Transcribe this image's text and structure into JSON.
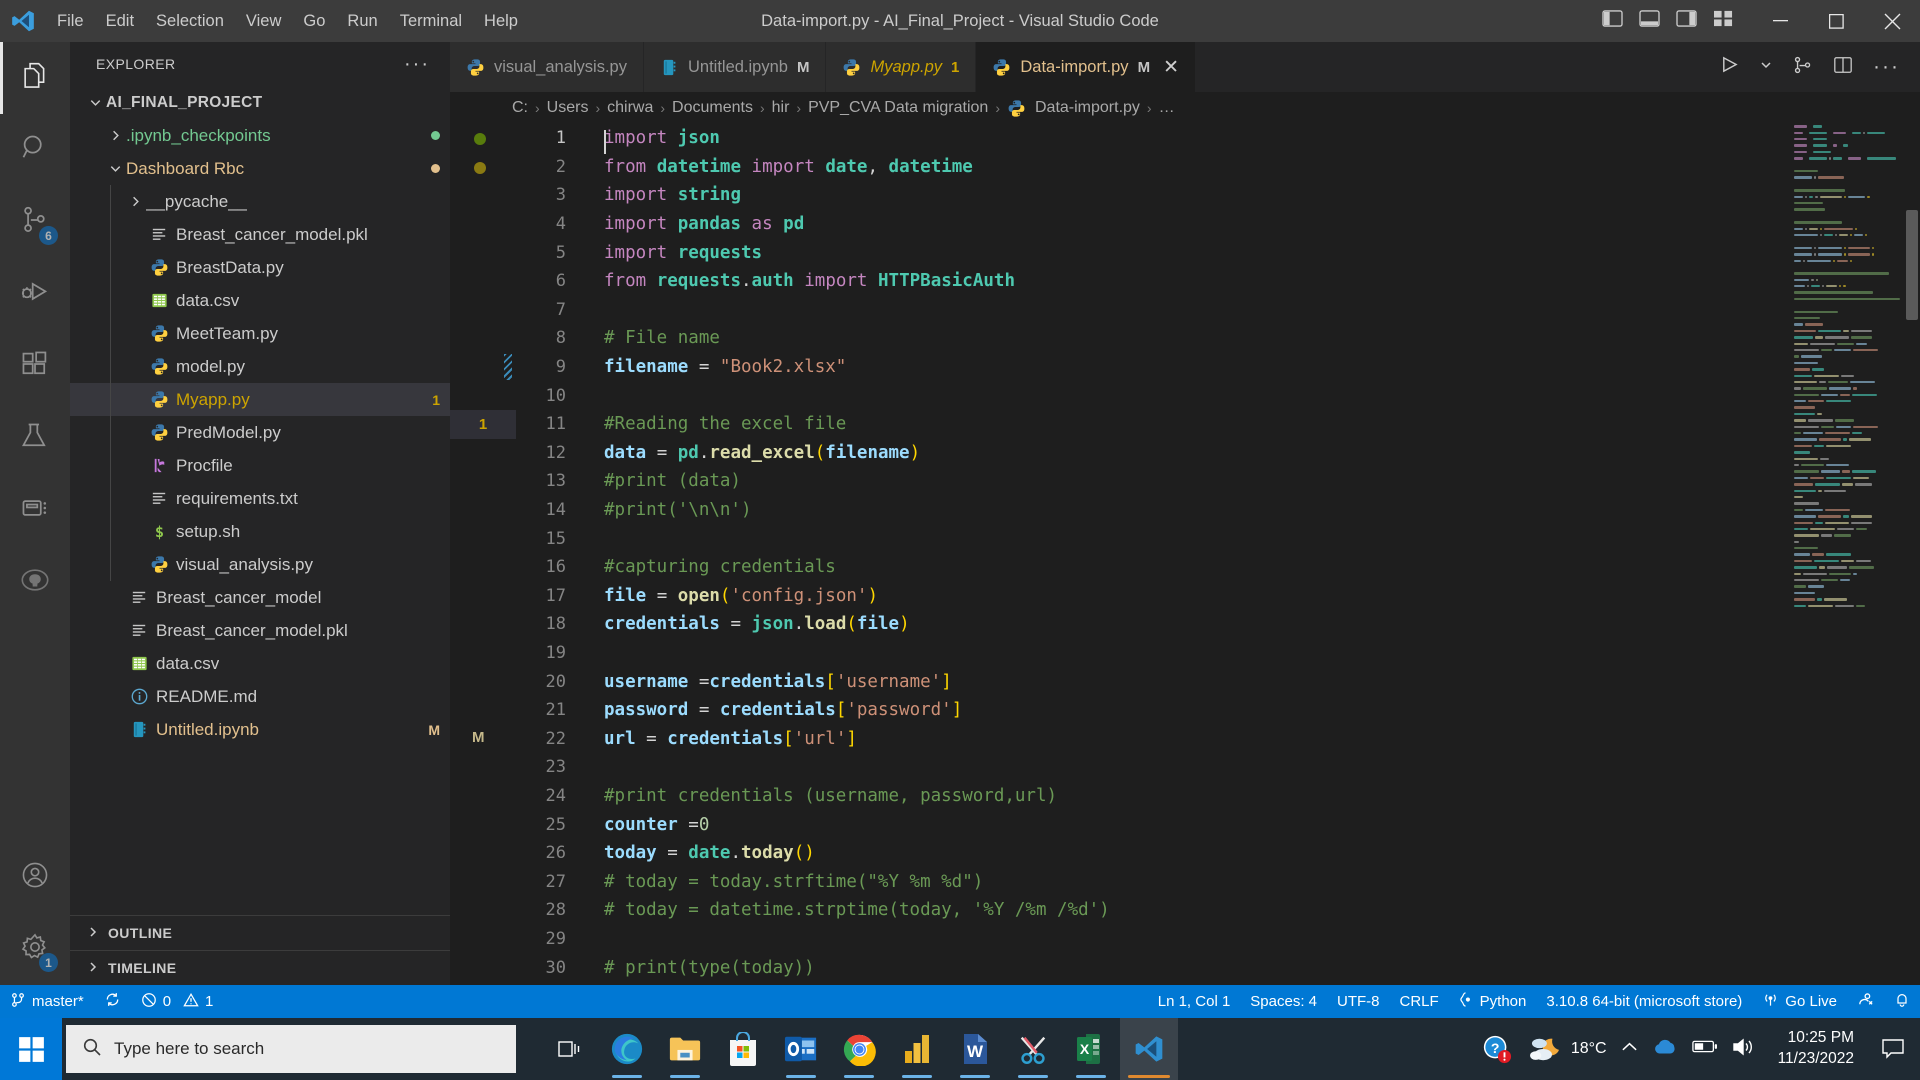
{
  "titlebar": {
    "logo_icon": "vscode-logo-icon",
    "menus": [
      "File",
      "Edit",
      "Selection",
      "View",
      "Go",
      "Run",
      "Terminal",
      "Help"
    ],
    "window_title": "Data-import.py - AI_Final_Project - Visual Studio Code",
    "layout_icons": [
      "toggle-primary-sidebar-icon",
      "toggle-panel-icon",
      "toggle-secondary-sidebar-icon",
      "customize-layout-icon"
    ],
    "window_controls": [
      "minimize-icon",
      "maximize-icon",
      "close-icon"
    ]
  },
  "activitybar": {
    "items": [
      {
        "name": "explorer",
        "icon": "files-icon",
        "active": true,
        "badge": ""
      },
      {
        "name": "search",
        "icon": "search-icon",
        "active": false,
        "badge": ""
      },
      {
        "name": "source-control",
        "icon": "source-control-icon",
        "active": false,
        "badge": "6"
      },
      {
        "name": "run-and-debug",
        "icon": "run-debug-icon",
        "active": false,
        "badge": ""
      },
      {
        "name": "extensions",
        "icon": "extensions-icon",
        "active": false,
        "badge": ""
      },
      {
        "name": "testing",
        "icon": "beaker-icon",
        "active": false,
        "badge": ""
      },
      {
        "name": "remote-explorer",
        "icon": "remote-explorer-icon",
        "active": false,
        "badge": ""
      },
      {
        "name": "github",
        "icon": "github-icon",
        "active": false,
        "badge": ""
      }
    ],
    "bottom": [
      {
        "name": "accounts",
        "icon": "account-icon",
        "badge": ""
      },
      {
        "name": "settings",
        "icon": "gear-icon",
        "badge": "1"
      }
    ]
  },
  "sidebar": {
    "title": "EXPLORER",
    "more_actions": "···",
    "tree": [
      {
        "label": "AI_FINAL_PROJECT",
        "depth": 0,
        "kind": "root",
        "chevron": "down",
        "icon": "",
        "badge": "",
        "color": "#cccccc",
        "dot": "",
        "selected": false
      },
      {
        "label": ".ipynb_checkpoints",
        "depth": 1,
        "kind": "folder",
        "chevron": "right",
        "icon": "",
        "badge": "",
        "color": "#73c991",
        "dot": "#73c991",
        "selected": false
      },
      {
        "label": "Dashboard Rbc",
        "depth": 1,
        "kind": "folder",
        "chevron": "down",
        "icon": "",
        "badge": "",
        "color": "#e2c08d",
        "dot": "#e2c08d",
        "selected": false
      },
      {
        "label": "__pycache__",
        "depth": 2,
        "kind": "folder",
        "chevron": "right",
        "icon": "",
        "badge": "",
        "color": "#cccccc",
        "dot": "",
        "selected": false
      },
      {
        "label": "Breast_cancer_model.pkl",
        "depth": 2,
        "kind": "file",
        "chevron": "",
        "icon": "lines-file-icon",
        "badge": "",
        "color": "#cccccc",
        "dot": "",
        "selected": false
      },
      {
        "label": "BreastData.py",
        "depth": 2,
        "kind": "file",
        "chevron": "",
        "icon": "python-icon",
        "badge": "",
        "color": "#cccccc",
        "dot": "",
        "selected": false
      },
      {
        "label": "data.csv",
        "depth": 2,
        "kind": "file",
        "chevron": "",
        "icon": "csv-icon",
        "badge": "",
        "color": "#cccccc",
        "dot": "",
        "selected": false
      },
      {
        "label": "MeetTeam.py",
        "depth": 2,
        "kind": "file",
        "chevron": "",
        "icon": "python-icon",
        "badge": "",
        "color": "#cccccc",
        "dot": "",
        "selected": false
      },
      {
        "label": "model.py",
        "depth": 2,
        "kind": "file",
        "chevron": "",
        "icon": "python-icon",
        "badge": "",
        "color": "#cccccc",
        "dot": "",
        "selected": false
      },
      {
        "label": "Myapp.py",
        "depth": 2,
        "kind": "file",
        "chevron": "",
        "icon": "python-icon",
        "badge": "1",
        "color": "#cda400",
        "dot": "",
        "selected": true
      },
      {
        "label": "PredModel.py",
        "depth": 2,
        "kind": "file",
        "chevron": "",
        "icon": "python-icon",
        "badge": "",
        "color": "#cccccc",
        "dot": "",
        "selected": false
      },
      {
        "label": "Procfile",
        "depth": 2,
        "kind": "file",
        "chevron": "",
        "icon": "heroku-icon",
        "badge": "",
        "color": "#cccccc",
        "dot": "",
        "selected": false
      },
      {
        "label": "requirements.txt",
        "depth": 2,
        "kind": "file",
        "chevron": "",
        "icon": "lines-file-icon",
        "badge": "",
        "color": "#cccccc",
        "dot": "",
        "selected": false
      },
      {
        "label": "setup.sh",
        "depth": 2,
        "kind": "file",
        "chevron": "",
        "icon": "shell-icon",
        "badge": "",
        "color": "#cccccc",
        "dot": "",
        "selected": false
      },
      {
        "label": "visual_analysis.py",
        "depth": 2,
        "kind": "file",
        "chevron": "",
        "icon": "python-icon",
        "badge": "",
        "color": "#cccccc",
        "dot": "",
        "selected": false
      },
      {
        "label": "Breast_cancer_model",
        "depth": 1,
        "kind": "file",
        "chevron": "",
        "icon": "lines-file-icon",
        "badge": "",
        "color": "#cccccc",
        "dot": "",
        "selected": false
      },
      {
        "label": "Breast_cancer_model.pkl",
        "depth": 1,
        "kind": "file",
        "chevron": "",
        "icon": "lines-file-icon",
        "badge": "",
        "color": "#cccccc",
        "dot": "",
        "selected": false
      },
      {
        "label": "data.csv",
        "depth": 1,
        "kind": "file",
        "chevron": "",
        "icon": "csv-icon",
        "badge": "",
        "color": "#cccccc",
        "dot": "",
        "selected": false
      },
      {
        "label": "README.md",
        "depth": 1,
        "kind": "file",
        "chevron": "",
        "icon": "info-icon",
        "badge": "",
        "color": "#cccccc",
        "dot": "",
        "selected": false
      },
      {
        "label": "Untitled.ipynb",
        "depth": 1,
        "kind": "file",
        "chevron": "",
        "icon": "notebook-icon",
        "badge": "M",
        "color": "#e2c08d",
        "dot": "",
        "selected": false
      }
    ],
    "sections": [
      {
        "label": "OUTLINE",
        "chevron": "right"
      },
      {
        "label": "TIMELINE",
        "chevron": "right"
      }
    ]
  },
  "tabs": [
    {
      "label": "visual_analysis.py",
      "icon": "python-icon",
      "modified": "",
      "active": false,
      "italic": false,
      "close": false
    },
    {
      "label": "Untitled.ipynb",
      "icon": "notebook-icon",
      "modified": "M",
      "active": false,
      "italic": false,
      "close": false
    },
    {
      "label": "Myapp.py",
      "icon": "python-icon",
      "modified": "1",
      "active": false,
      "italic": true,
      "close": false
    },
    {
      "label": "Data-import.py",
      "icon": "python-icon",
      "modified": "M",
      "active": true,
      "italic": false,
      "close": true
    }
  ],
  "tabbar_actions": [
    "run-python-file-icon",
    "chevron-down-icon",
    "split-source-control-icon",
    "split-editor-right-icon",
    "more-actions-icon"
  ],
  "breadcrumb": {
    "separator": "›",
    "items": [
      "C:",
      "Users",
      "chirwa",
      "Documents",
      "hir",
      "PVP_CVA Data migration",
      "Data-import.py",
      "…"
    ],
    "file_icon_index": 6
  },
  "editor": {
    "glyph_markers": [
      {
        "line": 1,
        "type": "dot",
        "color": "#587c0c"
      },
      {
        "line": 2,
        "type": "dot",
        "color": "#8a7a12"
      },
      {
        "line": 11,
        "type": "badge",
        "text": "1"
      },
      {
        "line": 22,
        "type": "text",
        "text": "M"
      }
    ],
    "cursor": {
      "line": 1,
      "column": 1
    },
    "code": [
      {
        "n": 1,
        "tokens": [
          [
            "k",
            "import"
          ],
          [
            "op",
            " "
          ],
          [
            "mod",
            "json"
          ]
        ]
      },
      {
        "n": 2,
        "tokens": [
          [
            "k",
            "from"
          ],
          [
            "op",
            " "
          ],
          [
            "mod",
            "datetime"
          ],
          [
            "op",
            " "
          ],
          [
            "k",
            "import"
          ],
          [
            "op",
            " "
          ],
          [
            "mod",
            "date"
          ],
          [
            "op",
            ", "
          ],
          [
            "mod",
            "datetime"
          ]
        ]
      },
      {
        "n": 3,
        "tokens": [
          [
            "k",
            "import"
          ],
          [
            "op",
            " "
          ],
          [
            "mod",
            "string"
          ]
        ]
      },
      {
        "n": 4,
        "tokens": [
          [
            "k",
            "import"
          ],
          [
            "op",
            " "
          ],
          [
            "mod",
            "pandas"
          ],
          [
            "op",
            " "
          ],
          [
            "k",
            "as"
          ],
          [
            "op",
            " "
          ],
          [
            "mod",
            "pd"
          ]
        ]
      },
      {
        "n": 5,
        "tokens": [
          [
            "k",
            "import"
          ],
          [
            "op",
            " "
          ],
          [
            "mod",
            "requests"
          ]
        ]
      },
      {
        "n": 6,
        "tokens": [
          [
            "k",
            "from"
          ],
          [
            "op",
            " "
          ],
          [
            "mod",
            "requests"
          ],
          [
            "op",
            "."
          ],
          [
            "mod",
            "auth"
          ],
          [
            "op",
            " "
          ],
          [
            "k",
            "import"
          ],
          [
            "op",
            " "
          ],
          [
            "cls",
            "HTTPBasicAuth"
          ]
        ]
      },
      {
        "n": 7,
        "tokens": []
      },
      {
        "n": 8,
        "tokens": [
          [
            "cm",
            "# File name"
          ]
        ]
      },
      {
        "n": 9,
        "tokens": [
          [
            "var",
            "filename"
          ],
          [
            "op",
            " = "
          ],
          [
            "str",
            "\"Book2.xlsx\""
          ]
        ]
      },
      {
        "n": 10,
        "tokens": []
      },
      {
        "n": 11,
        "tokens": [
          [
            "cm",
            "#Reading the excel file"
          ]
        ]
      },
      {
        "n": 12,
        "tokens": [
          [
            "var",
            "data"
          ],
          [
            "op",
            " = "
          ],
          [
            "mod",
            "pd"
          ],
          [
            "op",
            "."
          ],
          [
            "fn",
            "read_excel"
          ],
          [
            "br1",
            "("
          ],
          [
            "var",
            "filename"
          ],
          [
            "br1",
            ")"
          ]
        ]
      },
      {
        "n": 13,
        "tokens": [
          [
            "cm",
            "#print (data)"
          ]
        ]
      },
      {
        "n": 14,
        "tokens": [
          [
            "cm",
            "#print('\\n\\n')"
          ]
        ]
      },
      {
        "n": 15,
        "tokens": []
      },
      {
        "n": 16,
        "tokens": [
          [
            "cm",
            "#capturing credentials"
          ]
        ]
      },
      {
        "n": 17,
        "tokens": [
          [
            "var",
            "file"
          ],
          [
            "op",
            " = "
          ],
          [
            "fn",
            "open"
          ],
          [
            "br1",
            "("
          ],
          [
            "str",
            "'config.json'"
          ],
          [
            "br1",
            ")"
          ]
        ]
      },
      {
        "n": 18,
        "tokens": [
          [
            "var",
            "credentials"
          ],
          [
            "op",
            " = "
          ],
          [
            "mod",
            "json"
          ],
          [
            "op",
            "."
          ],
          [
            "fn",
            "load"
          ],
          [
            "br1",
            "("
          ],
          [
            "var",
            "file"
          ],
          [
            "br1",
            ")"
          ]
        ]
      },
      {
        "n": 19,
        "tokens": []
      },
      {
        "n": 20,
        "tokens": [
          [
            "var",
            "username"
          ],
          [
            "op",
            " ="
          ],
          [
            "var",
            "credentials"
          ],
          [
            "br1",
            "["
          ],
          [
            "str",
            "'username'"
          ],
          [
            "br1",
            "]"
          ]
        ]
      },
      {
        "n": 21,
        "tokens": [
          [
            "var",
            "password"
          ],
          [
            "op",
            " = "
          ],
          [
            "var",
            "credentials"
          ],
          [
            "br1",
            "["
          ],
          [
            "str",
            "'password'"
          ],
          [
            "br1",
            "]"
          ]
        ]
      },
      {
        "n": 22,
        "tokens": [
          [
            "var",
            "url"
          ],
          [
            "op",
            " = "
          ],
          [
            "var",
            "credentials"
          ],
          [
            "br1",
            "["
          ],
          [
            "str",
            "'url'"
          ],
          [
            "br1",
            "]"
          ]
        ]
      },
      {
        "n": 23,
        "tokens": []
      },
      {
        "n": 24,
        "tokens": [
          [
            "cm",
            "#print credentials (username, password,url)"
          ]
        ]
      },
      {
        "n": 25,
        "tokens": [
          [
            "var",
            "counter"
          ],
          [
            "op",
            " ="
          ],
          [
            "num",
            "0"
          ]
        ]
      },
      {
        "n": 26,
        "tokens": [
          [
            "var",
            "today"
          ],
          [
            "op",
            " = "
          ],
          [
            "mod",
            "date"
          ],
          [
            "op",
            "."
          ],
          [
            "fn",
            "today"
          ],
          [
            "br1",
            "("
          ],
          [
            "br1",
            ")"
          ]
        ]
      },
      {
        "n": 27,
        "tokens": [
          [
            "cm",
            "# today = today.strftime(\"%Y %m %d\")"
          ]
        ]
      },
      {
        "n": 28,
        "tokens": [
          [
            "cm",
            "# today = datetime.strptime(today, '%Y /%m /%d')"
          ]
        ]
      },
      {
        "n": 29,
        "tokens": []
      },
      {
        "n": 30,
        "tokens": [
          [
            "cm",
            "# print(type(today))"
          ]
        ]
      }
    ]
  },
  "statusbar": {
    "left": [
      {
        "icon": "source-control-branch-icon",
        "label": "master*"
      },
      {
        "icon": "sync-icon",
        "label": ""
      },
      {
        "icon": "error-icon",
        "label": "0",
        "icon2": "warning-icon",
        "label2": "1"
      }
    ],
    "branch": "master*",
    "sync_icon": "sync-icon",
    "errors_icon": "error-circle-icon",
    "errors": "0",
    "warnings_icon": "warning-triangle-icon",
    "warnings": "1",
    "cursor_position": "Ln 1, Col 1",
    "indentation": "Spaces: 4",
    "encoding": "UTF-8",
    "eol": "CRLF",
    "language_icon": "python-braces-icon",
    "language": "Python",
    "interpreter": "3.10.8 64-bit (microsoft store)",
    "golive_icon": "broadcast-icon",
    "golive": "Go Live",
    "remote_icon": "remote-window-icon",
    "bell_icon": "bell-icon"
  },
  "taskbar": {
    "start_icon": "windows-start-icon",
    "search_icon": "search-icon",
    "search_placeholder": "Type here to search",
    "task_view_icon": "task-view-icon",
    "apps": [
      {
        "name": "microsoft-edge",
        "icon": "edge-icon",
        "running": true,
        "active": false
      },
      {
        "name": "file-explorer",
        "icon": "folder-icon",
        "running": true,
        "active": false
      },
      {
        "name": "microsoft-store",
        "icon": "store-icon",
        "running": false,
        "active": false
      },
      {
        "name": "outlook",
        "icon": "outlook-icon",
        "running": true,
        "active": false
      },
      {
        "name": "google-chrome",
        "icon": "chrome-icon",
        "running": true,
        "active": false
      },
      {
        "name": "power-bi",
        "icon": "powerbi-icon",
        "running": true,
        "active": false
      },
      {
        "name": "microsoft-word",
        "icon": "word-icon",
        "running": true,
        "active": false
      },
      {
        "name": "snipping-tool",
        "icon": "snip-icon",
        "running": true,
        "active": false
      },
      {
        "name": "microsoft-excel",
        "icon": "excel-icon",
        "running": true,
        "active": false
      },
      {
        "name": "visual-studio-code",
        "icon": "vscode-icon",
        "running": true,
        "active": true
      }
    ],
    "tray": {
      "help_icon": "help-alert-icon",
      "weather_icon": "partly-cloudy-night-icon",
      "temperature": "18°C",
      "chevron_icon": "show-hidden-icons-icon",
      "onedrive_icon": "onedrive-icon",
      "battery_icon": "battery-icon",
      "volume_icon": "volume-icon",
      "time": "10:25 PM",
      "date": "11/23/2022",
      "notifications_icon": "action-center-icon"
    }
  }
}
